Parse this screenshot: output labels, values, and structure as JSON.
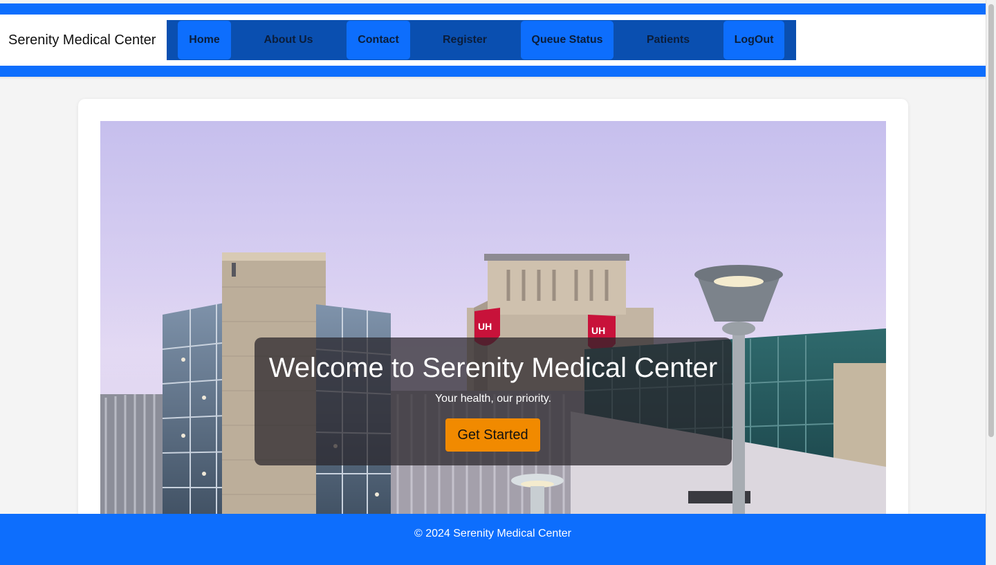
{
  "brand": {
    "name": "Serenity Medical Center"
  },
  "nav": {
    "items": [
      {
        "label": "Home",
        "active": true
      },
      {
        "label": "About Us",
        "active": false
      },
      {
        "label": "Contact",
        "active": true
      },
      {
        "label": "Register",
        "active": false
      },
      {
        "label": "Queue Status",
        "active": true
      },
      {
        "label": "Patients",
        "active": false
      },
      {
        "label": "LogOut",
        "active": true
      }
    ]
  },
  "hero": {
    "title": "Welcome to Serenity Medical Center",
    "tagline": "Your health, our priority.",
    "cta_label": "Get Started",
    "image": "hospital-building-photo",
    "building_signs": [
      "UH",
      "UH"
    ]
  },
  "footer": {
    "copyright": "© 2024 Serenity Medical Center"
  },
  "colors": {
    "primary": "#0d6efd",
    "nav_background": "#0a4fb0",
    "cta": "#f18a00",
    "page_background": "#f4f4f4"
  }
}
